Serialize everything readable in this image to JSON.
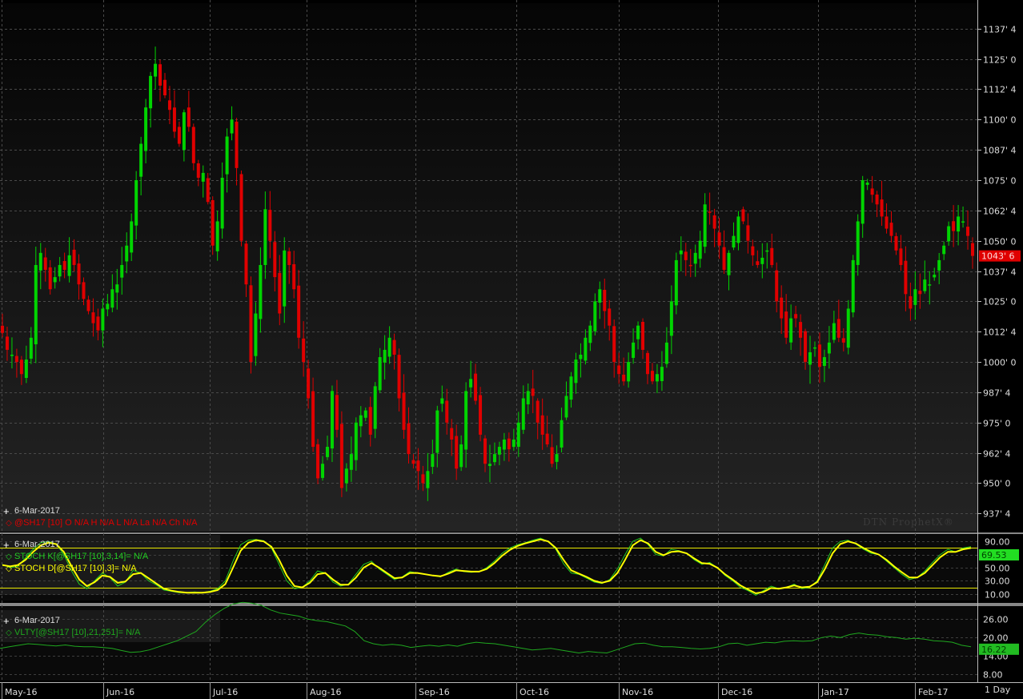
{
  "watermark": "DTN ProphetX®",
  "period_label": "1 Day",
  "colors": {
    "up": "#00d400",
    "down": "#e00000",
    "stoch_k": "#22cc22",
    "stoch_d": "#ffff00",
    "vlty": "#1fa81f",
    "price_box": "#e00000",
    "stoch_box": "#22dd22",
    "vlty_box": "#22bb22"
  },
  "panels": {
    "price": {
      "date": "6-Mar-2017",
      "study": "@SH17 [10] O  N/A H  N/A L  N/A La N/A Ch N/A",
      "last_value": "1043' 6"
    },
    "stoch": {
      "date": "6-Mar-2017",
      "k_label": "STOCH K[@SH17 [10],3,14]= N/A",
      "d_label": "STOCH D[@SH17 [10],3]= N/A",
      "last_value": "69.53"
    },
    "vlty": {
      "date": "6-Mar-2017",
      "label": "VLTY[@SH17 [10],21,251]= N/A",
      "last_value": "16.22"
    }
  },
  "chart_data": [
    {
      "type": "candlestick",
      "panel": "price",
      "symbol": "@SH17 [10]",
      "ytick_labels": [
        "1137' 4",
        "1125' 0",
        "1112' 4",
        "1100' 0",
        "1087' 4",
        "1075' 0",
        "1062' 4",
        "1050' 0",
        "1037' 4",
        "1025' 0",
        "1012' 4",
        "1000' 0",
        "987' 4",
        "975' 0",
        "962' 4",
        "950' 0",
        "937' 4"
      ],
      "ytick_values": [
        1137.5,
        1125,
        1112.5,
        1100,
        1087.5,
        1075,
        1062.5,
        1050,
        1037.5,
        1025,
        1012.5,
        1000,
        987.5,
        975,
        962.5,
        950,
        937.5
      ],
      "ylim": [
        930,
        1148
      ],
      "x_labels": [
        "May-16",
        "Jun-16",
        "Jul-16",
        "Aug-16",
        "Sep-16",
        "Oct-16",
        "Nov-16",
        "Dec-16",
        "Jan-17",
        "Feb-17"
      ],
      "close_path": [
        1012,
        1005,
        1003,
        1000,
        995,
        1001,
        1010,
        1040,
        1045,
        1038,
        1030,
        1035,
        1040,
        1038,
        1044,
        1040,
        1032,
        1026,
        1021,
        1016,
        1013,
        1022,
        1024,
        1030,
        1032,
        1040,
        1048,
        1058,
        1075,
        1090,
        1105,
        1118,
        1123,
        1114,
        1110,
        1104,
        1095,
        1090,
        1103,
        1097,
        1082,
        1076,
        1078,
        1066,
        1048,
        1058,
        1076,
        1093,
        1100,
        1080,
        1050,
        1032,
        1000,
        1020,
        1040,
        1063,
        1050,
        1035,
        1020,
        1046,
        1040,
        1030,
        1010,
        1000,
        985,
        965,
        952,
        958,
        965,
        988,
        972,
        948,
        956,
        962,
        975,
        978,
        980,
        970,
        990,
        1002,
        1005,
        1010,
        1003,
        985,
        972,
        962,
        958,
        955,
        950,
        955,
        962,
        980,
        985,
        975,
        968,
        956,
        966,
        988,
        993,
        984,
        970,
        958,
        958,
        962,
        965,
        968,
        964,
        968,
        975,
        985,
        988,
        986,
        975,
        970,
        966,
        958,
        962,
        976,
        986,
        994,
        1001,
        1003,
        1010,
        1015,
        1025,
        1030,
        1021,
        1015,
        1000,
        995,
        992,
        1000,
        1008,
        1015,
        1005,
        995,
        992,
        995,
        998,
        1008,
        1025,
        1042,
        1046,
        1042,
        1040,
        1045,
        1050,
        1065,
        1062,
        1055,
        1048,
        1038,
        1045,
        1052,
        1060,
        1058,
        1050,
        1044,
        1040,
        1043,
        1046,
        1040,
        1025,
        1018,
        1010,
        1018,
        1018,
        1010,
        1000,
        1004,
        1006,
        998,
        1002,
        1008,
        1016,
        1010,
        1008,
        1022,
        1042,
        1058,
        1075,
        1074,
        1069,
        1065,
        1060,
        1055,
        1052,
        1046,
        1040,
        1028,
        1022,
        1030,
        1028,
        1034,
        1032,
        1036,
        1042,
        1048,
        1056,
        1054,
        1060,
        1058,
        1052,
        1043.75
      ],
      "last": 1043.75
    },
    {
      "type": "line",
      "panel": "stoch",
      "ytick_labels": [
        "90.00",
        "70.00",
        "50.00",
        "30.00",
        "10.00"
      ],
      "ytick_values": [
        90,
        70,
        50,
        30,
        10
      ],
      "ylim": [
        0,
        100
      ],
      "reference_lines": [
        80,
        20
      ],
      "series": [
        {
          "name": "STOCH K",
          "values": [
            55,
            50,
            52,
            65,
            78,
            88,
            90,
            86,
            70,
            45,
            25,
            18,
            30,
            42,
            35,
            22,
            28,
            46,
            42,
            30,
            24,
            16,
            14,
            12,
            12,
            13,
            12,
            14,
            18,
            30,
            60,
            85,
            92,
            93,
            91,
            80,
            55,
            30,
            18,
            20,
            30,
            45,
            42,
            28,
            22,
            25,
            40,
            55,
            60,
            48,
            40,
            32,
            36,
            44,
            42,
            40,
            38,
            36,
            43,
            48,
            44,
            43,
            44,
            50,
            60,
            72,
            80,
            85,
            88,
            92,
            95,
            90,
            78,
            56,
            42,
            40,
            34,
            28,
            26,
            32,
            48,
            70,
            90,
            95,
            85,
            70,
            68,
            78,
            76,
            72,
            62,
            55,
            58,
            50,
            38,
            30,
            20,
            15,
            8,
            15,
            22,
            18,
            20,
            25,
            18,
            20,
            30,
            55,
            80,
            90,
            92,
            86,
            78,
            72,
            70,
            60,
            50,
            40,
            32,
            35,
            45,
            58,
            70,
            78,
            74,
            80,
            82
          ]
        },
        {
          "name": "STOCH D",
          "values": [
            54,
            52,
            54,
            62,
            74,
            84,
            88,
            86,
            74,
            52,
            32,
            22,
            28,
            38,
            36,
            27,
            29,
            40,
            42,
            34,
            26,
            18,
            15,
            13,
            12,
            12,
            12,
            13,
            16,
            25,
            50,
            76,
            88,
            92,
            90,
            82,
            62,
            38,
            22,
            20,
            27,
            40,
            42,
            32,
            24,
            24,
            35,
            50,
            57,
            50,
            42,
            34,
            35,
            42,
            42,
            40,
            38,
            37,
            41,
            46,
            45,
            44,
            44,
            48,
            57,
            68,
            77,
            83,
            87,
            90,
            93,
            90,
            80,
            62,
            46,
            41,
            36,
            30,
            27,
            30,
            42,
            62,
            84,
            92,
            87,
            74,
            69,
            74,
            75,
            72,
            64,
            57,
            56,
            50,
            40,
            32,
            23,
            17,
            11,
            13,
            19,
            18,
            20,
            23,
            20,
            21,
            28,
            48,
            72,
            86,
            90,
            87,
            80,
            74,
            70,
            62,
            52,
            43,
            35,
            35,
            42,
            54,
            66,
            74,
            74,
            78,
            80
          ]
        }
      ],
      "last": 69.53
    },
    {
      "type": "line",
      "panel": "vlty",
      "ytick_labels": [
        "26.00",
        "20.00",
        "14.00",
        "8.00"
      ],
      "ytick_values": [
        26,
        20,
        14,
        8
      ],
      "ylim": [
        6,
        30
      ],
      "series": [
        {
          "name": "VLTY",
          "values": [
            16.5,
            17,
            17.5,
            18,
            17.8,
            17.5,
            17.3,
            17.6,
            17.2,
            17,
            17,
            16.8,
            16.5,
            15.8,
            15.2,
            15.4,
            16,
            17,
            18,
            19,
            20.5,
            22,
            25,
            27.5,
            29.5,
            31,
            31.5,
            31.2,
            30.5,
            29,
            28,
            27.5,
            27,
            26,
            25.5,
            25.2,
            24.5,
            23.8,
            22,
            19,
            18,
            17.5,
            17.8,
            17.5,
            16.8,
            17.2,
            17.5,
            17.2,
            17.6,
            17.2,
            18,
            18.5,
            18.2,
            18,
            17.5,
            17,
            16.5,
            16,
            16.2,
            16.5,
            16,
            15.5,
            15,
            15.5,
            15.2,
            15,
            16,
            17,
            18,
            18.2,
            17.5,
            17,
            17,
            16.8,
            16.5,
            16.3,
            16.5,
            17,
            18,
            18.2,
            17.5,
            18,
            18.5,
            18.3,
            18.8,
            19,
            18.8,
            19,
            20,
            20.5,
            20,
            21,
            21.5,
            21,
            20.8,
            20.3,
            20,
            19.5,
            19.8,
            19.5,
            19,
            18.8,
            18.5,
            17.5,
            17
          ]
        }
      ],
      "last": 16.22
    }
  ]
}
